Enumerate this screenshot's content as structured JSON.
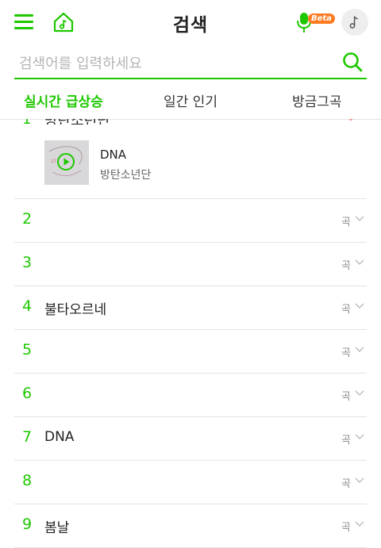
{
  "header": {
    "title": "검색",
    "beta_label": "Beta"
  },
  "search": {
    "placeholder": "검색어를 입력하세요"
  },
  "tabs": [
    {
      "label": "실시간 급상승",
      "active": true
    },
    {
      "label": "일간 인기",
      "active": false
    },
    {
      "label": "방금그곡",
      "active": false
    }
  ],
  "detail": {
    "song": "DNA",
    "artist": "방탄소년단"
  },
  "rows": [
    {
      "rank": "2",
      "song": "",
      "type": "곡"
    },
    {
      "rank": "3",
      "song": "",
      "type": "곡"
    },
    {
      "rank": "4",
      "song": "불타오르네",
      "type": "곡"
    },
    {
      "rank": "5",
      "song": "",
      "type": "곡"
    },
    {
      "rank": "6",
      "song": "",
      "type": "곡"
    },
    {
      "rank": "7",
      "song": "DNA",
      "type": "곡"
    },
    {
      "rank": "8",
      "song": "",
      "type": "곡"
    },
    {
      "rank": "9",
      "song": "봄날",
      "type": "곡"
    }
  ],
  "colors": {
    "accent": "#1ec800",
    "beta": "#ff7a21"
  }
}
